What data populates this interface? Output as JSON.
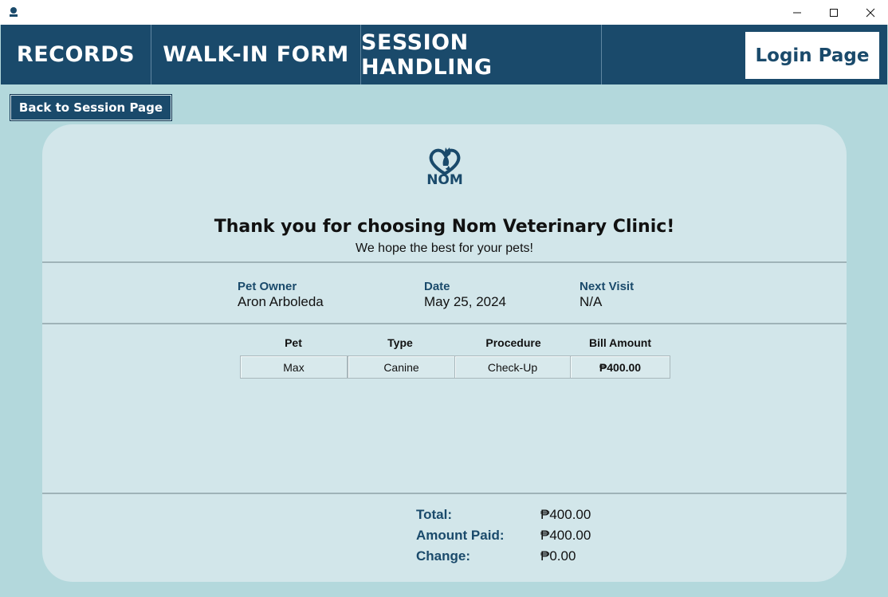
{
  "window": {
    "app_icon": "nom-logo-icon",
    "controls": {
      "minimize": "minimize-icon",
      "maximize": "maximize-icon",
      "close": "close-icon"
    }
  },
  "nav": {
    "records": "RECORDS",
    "walkin": "WALK-IN FORM",
    "session": "SESSION HANDLING",
    "login": "Login Page"
  },
  "back_button": "Back to Session Page",
  "receipt": {
    "logo_text": "NOM",
    "title": "Thank you for choosing Nom Veterinary Clinic!",
    "subtitle": "We hope the best for your pets!",
    "info": {
      "owner_label": "Pet Owner",
      "owner_value": "Aron Arboleda",
      "date_label": "Date",
      "date_value": "May 25, 2024",
      "next_label": "Next Visit",
      "next_value": "N/A"
    },
    "table": {
      "headers": [
        "Pet",
        "Type",
        "Procedure",
        "Bill Amount"
      ],
      "rows": [
        [
          "Max",
          "Canine",
          "Check-Up",
          "₱400.00"
        ]
      ]
    },
    "summary": {
      "total_label": "Total:",
      "total_value": "₱400.00",
      "paid_label": "Amount Paid:",
      "paid_value": "₱400.00",
      "change_label": "Change:",
      "change_value": "₱0.00"
    }
  },
  "colors": {
    "navy": "#1a4a6b",
    "background": "#b3d8dc",
    "card": "#d2e6ea"
  }
}
